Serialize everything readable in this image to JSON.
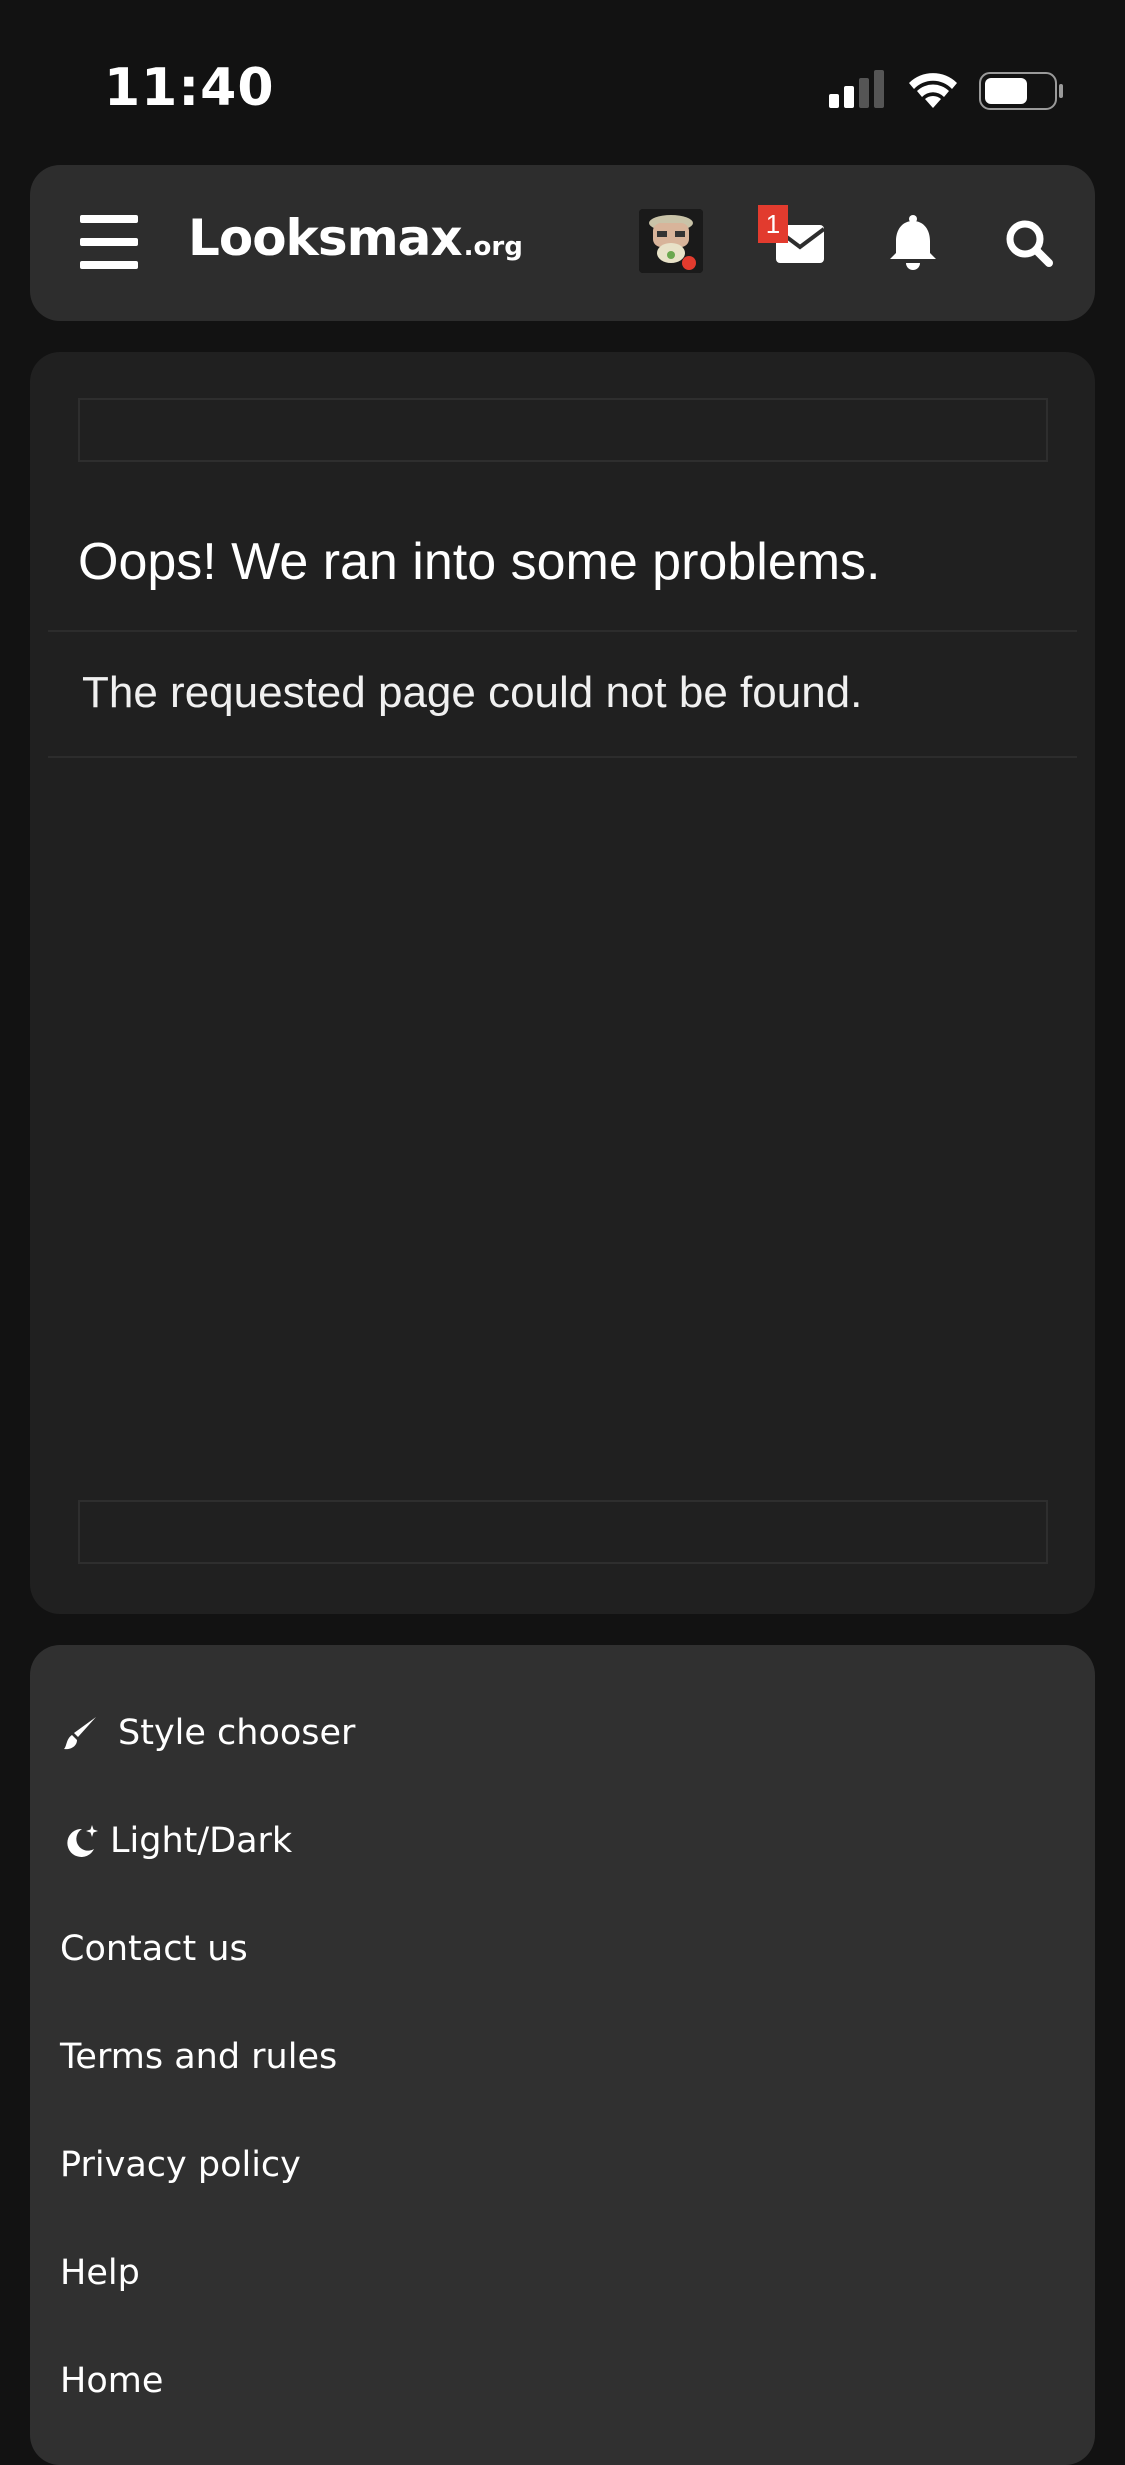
{
  "status_bar": {
    "time": "11:40",
    "icons": [
      "cellular-signal-icon",
      "wifi-icon",
      "battery-icon"
    ]
  },
  "header": {
    "logo_main": "Looksmax",
    "logo_sub": ".org",
    "mail_badge_count": "1",
    "icons": [
      "hamburger-menu-icon",
      "avatar",
      "mail-icon",
      "bell-icon",
      "search-icon"
    ]
  },
  "main": {
    "error_title": "Oops! We ran into some problems.",
    "error_message": "The requested page could not be found."
  },
  "footer": {
    "links": [
      {
        "label": "Style chooser",
        "icon": "paintbrush-icon"
      },
      {
        "label": "Light/Dark",
        "icon": "moon-stars-icon"
      },
      {
        "label": "Contact us"
      },
      {
        "label": "Terms and rules"
      },
      {
        "label": "Privacy policy"
      },
      {
        "label": "Help"
      },
      {
        "label": "Home"
      }
    ]
  },
  "colors": {
    "background": "#121212",
    "header_bg": "#2d2d2d",
    "card_bg": "#202020",
    "footer_bg": "#303030",
    "badge": "#e23b2e"
  }
}
